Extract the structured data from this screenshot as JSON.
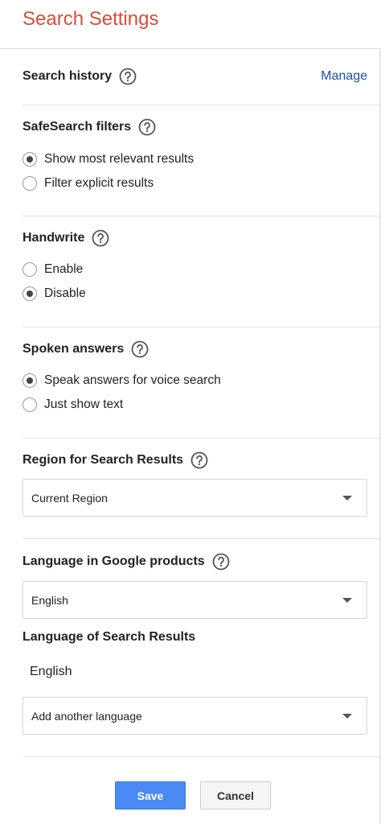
{
  "page": {
    "title": "Search Settings"
  },
  "search_history": {
    "heading": "Search history",
    "manage_link": "Manage"
  },
  "safesearch": {
    "heading": "SafeSearch filters",
    "options": [
      {
        "label": "Show most relevant results",
        "selected": true
      },
      {
        "label": "Filter explicit results",
        "selected": false
      }
    ]
  },
  "handwrite": {
    "heading": "Handwrite",
    "options": [
      {
        "label": "Enable",
        "selected": false
      },
      {
        "label": "Disable",
        "selected": true
      }
    ]
  },
  "spoken_answers": {
    "heading": "Spoken answers",
    "options": [
      {
        "label": "Speak answers for voice search",
        "selected": true
      },
      {
        "label": "Just show text",
        "selected": false
      }
    ]
  },
  "region": {
    "heading": "Region for Search Results",
    "selected": "Current Region"
  },
  "language_products": {
    "heading": "Language in Google products",
    "selected": "English"
  },
  "language_results": {
    "heading": "Language of Search Results",
    "current": "English",
    "add_placeholder": "Add another language"
  },
  "buttons": {
    "save": "Save",
    "cancel": "Cancel"
  },
  "colors": {
    "title": "#dd4b39",
    "link": "#1a4fb5",
    "primary_button": "#4a8af4"
  },
  "icons": {
    "help": "help-icon",
    "dropdown": "chevron-down-icon"
  }
}
